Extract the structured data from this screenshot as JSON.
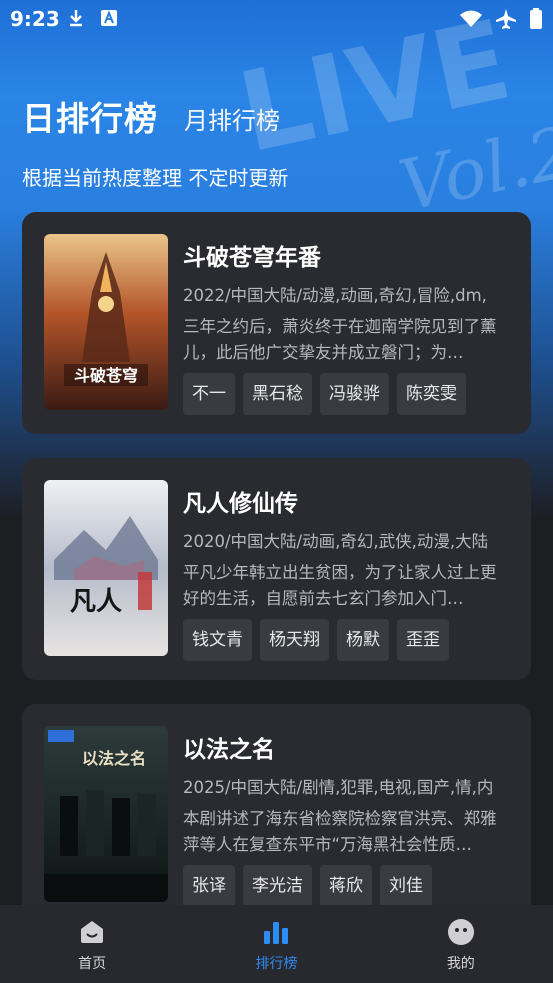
{
  "status_bar": {
    "time": "9:23"
  },
  "header": {
    "tab_daily": "日排行榜",
    "tab_monthly": "月排行榜",
    "subtitle": "根据当前热度整理 不定时更新"
  },
  "cards": [
    {
      "title": "斗破苍穹年番",
      "meta": "2022/中国大陆/动漫,动画,奇幻,冒险,dm,",
      "desc": "三年之约后，萧炎终于在迦南学院见到了薰儿，此后他广交挚友并成立磐门；为…",
      "tags": [
        "不一",
        "黑石稔",
        "冯骏骅",
        "陈奕雯"
      ]
    },
    {
      "title": "凡人修仙传",
      "meta": "2020/中国大陆/动画,奇幻,武侠,动漫,大陆",
      "desc": "平凡少年韩立出生贫困，为了让家人过上更好的生活，自愿前去七玄门参加入门…",
      "tags": [
        "钱文青",
        "杨天翔",
        "杨默",
        "歪歪"
      ]
    },
    {
      "title": "以法之名",
      "meta": "2025/中国大陆/剧情,犯罪,电视,国产,情,内",
      "desc": "本剧讲述了海东省检察院检察官洪亮、郑雅萍等人在复查东平市“万海黑社会性质…",
      "tags": [
        "张译",
        "李光洁",
        "蒋欣",
        "刘佳"
      ]
    }
  ],
  "posters": [
    {
      "text": "斗破苍穹"
    },
    {
      "text": "凡人"
    },
    {
      "text": "以法之名"
    }
  ],
  "bottom_nav": [
    {
      "label": "首页",
      "icon": "home-face-icon"
    },
    {
      "label": "排行榜",
      "icon": "bar-chart-icon"
    },
    {
      "label": "我的",
      "icon": "profile-face-icon"
    }
  ],
  "colors": {
    "accent": "#2d8cf0",
    "card_bg": "#2a2b30",
    "page_bg": "#1d1e22"
  }
}
